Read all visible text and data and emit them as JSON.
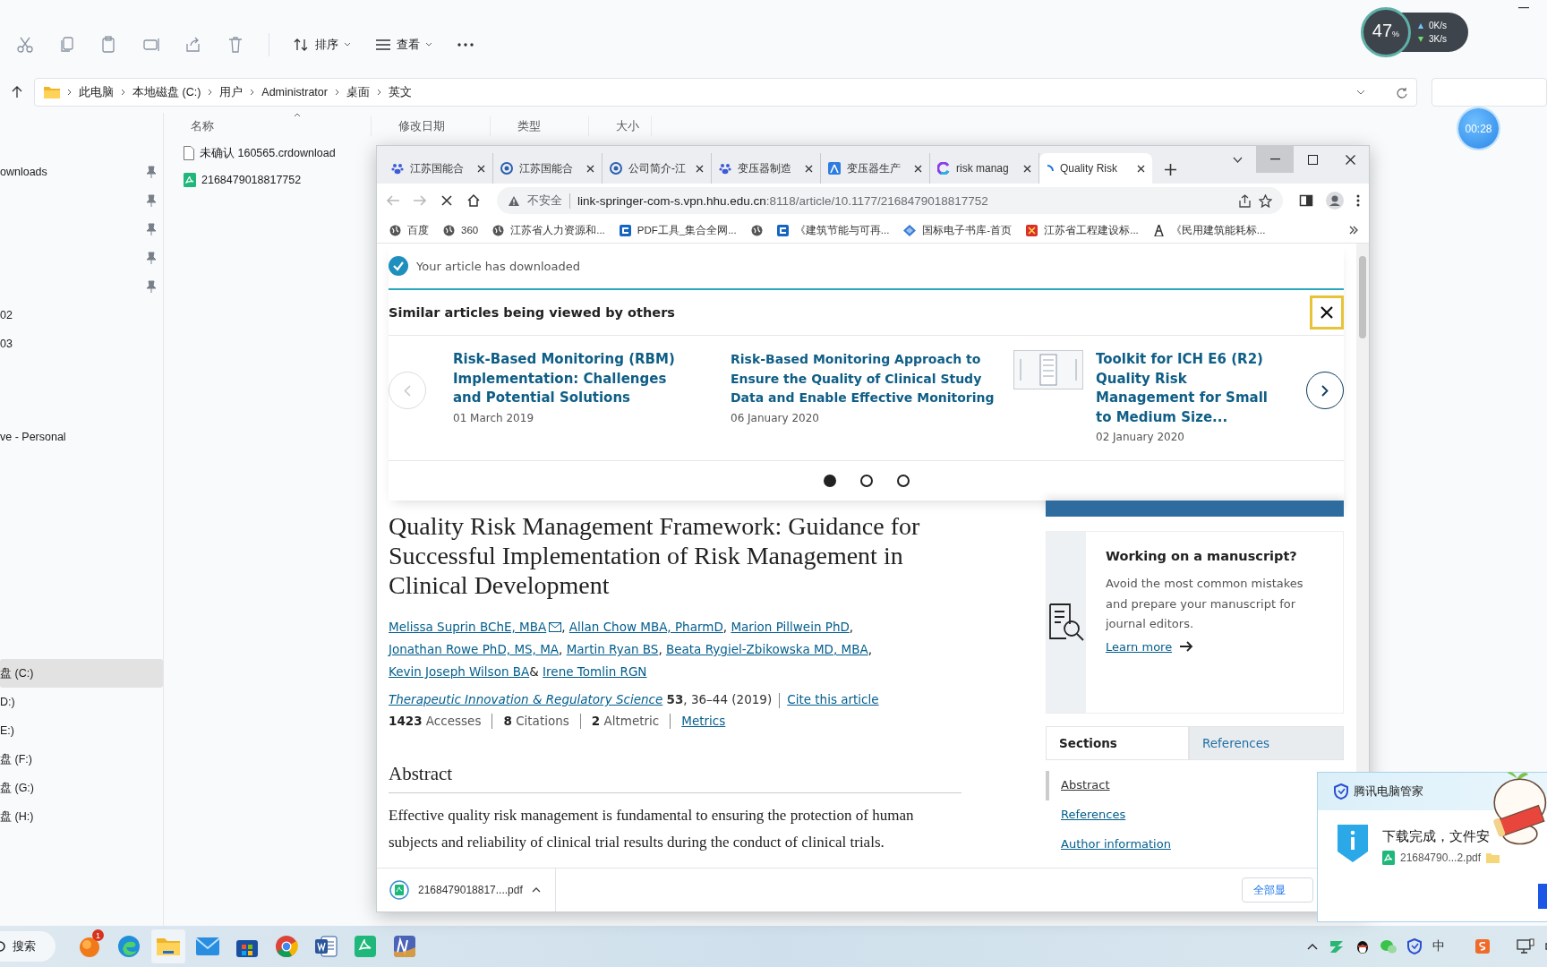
{
  "widget": {
    "percent": "47",
    "unit": "%",
    "up": "0K/s",
    "down": "3K/s"
  },
  "timer": "00:28",
  "explorer": {
    "toolbar": {
      "sort": "排序",
      "view": "查看"
    },
    "breadcrumb": [
      "此电脑",
      "本地磁盘 (C:)",
      "用户",
      "Administrator",
      "桌面",
      "英文"
    ],
    "columns": [
      "名称",
      "修改日期",
      "类型",
      "大小"
    ],
    "files": [
      {
        "name": "未确认 160565.crdownload",
        "kind": "file"
      },
      {
        "name": "2168479018817752",
        "kind": "pdf"
      }
    ],
    "sidebar": [
      [
        {
          "label": "ownloads",
          "pinned": true,
          "selected": false
        },
        {
          "pinned": true,
          "selected": false
        },
        {
          "pinned": true,
          "selected": false
        },
        {
          "pinned": true,
          "selected": false
        },
        {
          "pinned": true,
          "selected": false
        },
        {
          "label": "02",
          "pinned": false,
          "selected": false
        },
        {
          "label": "03",
          "pinned": false,
          "selected": false
        }
      ],
      [
        {
          "label": "ve - Personal",
          "pinned": false,
          "selected": false
        }
      ],
      [
        {
          "label": "盘 (C:)",
          "pinned": false,
          "selected": true
        },
        {
          "label": "D:)",
          "pinned": false,
          "selected": false
        },
        {
          "label": "E:)",
          "pinned": false,
          "selected": false
        },
        {
          "label": "盘 (F:)",
          "pinned": false,
          "selected": false
        },
        {
          "label": "盘 (G:)",
          "pinned": false,
          "selected": false
        },
        {
          "label": "盘 (H:)",
          "pinned": false,
          "selected": false
        }
      ]
    ]
  },
  "browser": {
    "tabs": [
      {
        "label": "江苏国能合",
        "kind": "paw",
        "selected": false
      },
      {
        "label": "江苏国能合",
        "kind": "circle",
        "selected": false
      },
      {
        "label": "公司简介-江",
        "kind": "circle",
        "selected": false
      },
      {
        "label": "变压器制造",
        "kind": "paw",
        "selected": false
      },
      {
        "label": "变压器生产",
        "kind": "square",
        "selected": false
      },
      {
        "label": "risk manag",
        "kind": "ring",
        "selected": false
      },
      {
        "label": "Quality Risk",
        "kind": "spinner",
        "selected": true
      }
    ],
    "security": "不安全",
    "host": "link-springer-com-s.vpn.hhu.edu.cn",
    "path": ":8118/article/10.1177/2168479018817752",
    "bookmarks": [
      {
        "label": "百度",
        "kind": "globe"
      },
      {
        "label": "360",
        "kind": "globe"
      },
      {
        "label": "江苏省人力资源和...",
        "kind": "globe"
      },
      {
        "label": "PDF工具_集合全网...",
        "kind": "square"
      },
      {
        "kind": "globe"
      },
      {
        "label": "《建筑节能与可再...",
        "kind": "square"
      },
      {
        "label": "国标电子书库-首页",
        "kind": "diamond"
      },
      {
        "label": "江苏省工程建设标...",
        "kind": "red"
      },
      {
        "label": "《民用建筑能耗标...",
        "kind": "tower"
      }
    ]
  },
  "page": {
    "notice": "Your article has downloaded",
    "similar": {
      "heading": "Similar articles being viewed by others",
      "articles": [
        {
          "title": "Risk-Based Monitoring (RBM) Implementation: Challenges and Potential Solutions",
          "date": "01 March 2019",
          "kind": "text"
        },
        {
          "title": "Risk-Based Monitoring Approach to Ensure the Quality of Clinical Study Data and Enable Effective Monitoring",
          "date": "06 January 2020",
          "kind": "text"
        },
        {
          "title": "Toolkit for ICH E6 (R2) Quality Risk Management for Small to Medium Size...",
          "date": "02 January 2020",
          "kind": "thumbnail"
        }
      ],
      "dots": [
        {
          "selected": true
        },
        {
          "selected": false
        },
        {
          "selected": false
        }
      ]
    },
    "article": {
      "title": "Quality Risk Management Framework: Guidance for Successful Implementation of Risk Management in Clinical Development",
      "authors": [
        {
          "name": "Melissa Suprin BChE, MBA",
          "email": true,
          "after": ","
        },
        {
          "name": "Allan Chow MBA, PharmD",
          "after": ","
        },
        {
          "name": "Marion Pillwein PhD",
          "after": ","
        },
        {
          "name": "Jonathan Rowe PhD, MS, MA",
          "after": ","
        },
        {
          "name": "Martin Ryan BS",
          "after": ","
        },
        {
          "name": "Beata Rygiel-Zbikowska MD, MBA",
          "after": ","
        },
        {
          "name": "Kevin Joseph Wilson BA",
          "after": "&"
        },
        {
          "name": "Irene Tomlin RGN"
        }
      ],
      "journal": "Therapeutic Innovation & Regulatory Science",
      "volume": "53",
      "pages": ", 36–44 (2019)",
      "cite": "Cite this article",
      "metrics": [
        "**1423** Accesses",
        "**8** Citations",
        "**2** Altmetric"
      ],
      "metrics_link": "Metrics",
      "abstract_heading": "Abstract",
      "abstract": "Effective quality risk management is fundamental to ensuring the protection of human subjects and reliability of clinical trial results during the conduct of clinical trials."
    },
    "aside": {
      "card_title": "Working on a manuscript?",
      "card_text": "Avoid the most common mistakes and prepare your manuscript for journal editors.",
      "card_link": "Learn more",
      "tabs": [
        {
          "label": "Sections",
          "selected": true
        },
        {
          "label": "References",
          "selected": false
        }
      ],
      "links": [
        {
          "label": "Abstract",
          "selected": true
        },
        {
          "label": "References",
          "selected": false
        },
        {
          "label": "Author information",
          "selected": false
        }
      ]
    }
  },
  "download_bar": {
    "file": "2168479018817....pdf",
    "show_all": "全部显"
  },
  "popup": {
    "app": "腾讯电脑管家",
    "message": "下载完成，文件安",
    "file": "21684790...2.pdf"
  },
  "taskbar": {
    "search": "搜索",
    "apps": [
      {
        "kind": "orange",
        "badge": "1",
        "active": false
      },
      {
        "kind": "edge",
        "active": false
      },
      {
        "kind": "folder",
        "active": true
      },
      {
        "kind": "mail",
        "active": false
      },
      {
        "kind": "store",
        "active": false
      },
      {
        "kind": "chrome",
        "active": false
      },
      {
        "kind": "word",
        "active": false
      },
      {
        "kind": "pdf",
        "active": false
      },
      {
        "kind": "ne",
        "active": false
      }
    ],
    "ime": "中"
  }
}
